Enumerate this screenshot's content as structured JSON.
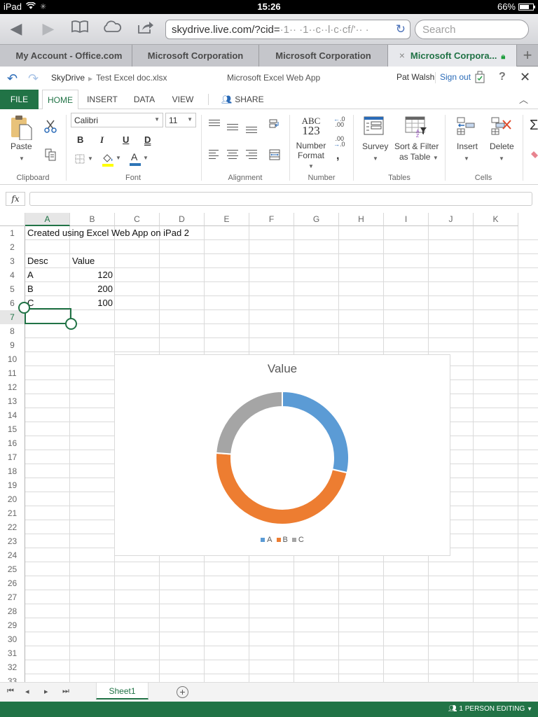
{
  "device_status": {
    "device": "iPad",
    "time": "15:26",
    "battery_percent": "66%",
    "battery_level": 0.66
  },
  "browser": {
    "url": "skydrive.live.com/?cid=",
    "url_obscured": "·1·· ·1··c··l·c·cf/'·· ·",
    "search_placeholder": "Search",
    "tabs": [
      {
        "label": "My Account - Office.com",
        "active": false
      },
      {
        "label": "Microsoft Corporation",
        "active": false
      },
      {
        "label": "Microsoft Corporation",
        "active": false
      },
      {
        "label": "Microsoft Corpora...",
        "active": true
      }
    ],
    "close_tab_glyph": "×",
    "new_tab_glyph": "+"
  },
  "app_header": {
    "breadcrumb_root": "SkyDrive",
    "file_name": "Test Excel doc.xlsx",
    "app_title": "Microsoft Excel Web App",
    "user_name": "Pat Walsh",
    "sign_out": "Sign out"
  },
  "ribbon_tabs": {
    "file": "FILE",
    "home": "HOME",
    "insert": "INSERT",
    "data": "DATA",
    "view": "VIEW",
    "share": "SHARE"
  },
  "ribbon": {
    "clipboard": {
      "paste": "Paste",
      "group_label": "Clipboard"
    },
    "font": {
      "font_name": "Calibri",
      "font_size": "11",
      "bold": "B",
      "italic": "I",
      "underline": "U",
      "double_underline": "D",
      "font_color_glyph": "A",
      "group_label": "Font",
      "highlight_color": "#ffff00",
      "font_color": "#2e75b6"
    },
    "alignment": {
      "group_label": "Alignment"
    },
    "number": {
      "abc_label": "ABC",
      "num_label": "123",
      "number_format_line1": "Number",
      "number_format_line2": "Format",
      "increase_decimal": "←.0 .00",
      "decrease_decimal": ".00 →.0",
      "comma": ",",
      "group_label": "Number"
    },
    "tables": {
      "survey": "Survey",
      "sort_filter_line1": "Sort & Filter",
      "sort_filter_line2": "as Table",
      "group_label": "Tables"
    },
    "cells": {
      "insert": "Insert",
      "delete": "Delete",
      "group_label": "Cells"
    },
    "editing": {
      "autosum_glyph": "Σ"
    }
  },
  "formula_bar": {
    "fx_label": "fx",
    "value": ""
  },
  "sheet": {
    "columns": [
      "A",
      "B",
      "C",
      "D",
      "E",
      "F",
      "G",
      "H",
      "I",
      "J",
      "K"
    ],
    "active_column": "A",
    "active_row": 7,
    "row_numbers": [
      "1",
      "2",
      "3",
      "4",
      "5",
      "6",
      "7",
      "8",
      "9",
      "10",
      "11",
      "12",
      "13",
      "14",
      "15",
      "16",
      "17",
      "18",
      "19",
      "20",
      "21",
      "22",
      "23",
      "24",
      "25",
      "26",
      "27",
      "28",
      "29",
      "30",
      "31",
      "32",
      "33"
    ],
    "cells": {
      "A1": "Created using Excel Web App on iPad 2",
      "A3": "Desc",
      "B3": "Value",
      "A4": "A",
      "B4": "120",
      "A5": "B",
      "B5": "200",
      "A6": "C",
      "B6": "100"
    }
  },
  "chart_data": {
    "type": "pie",
    "variant": "doughnut",
    "title": "Value",
    "categories": [
      "A",
      "B",
      "C"
    ],
    "values": [
      120,
      200,
      100
    ],
    "colors": [
      "#5b9bd5",
      "#ed7d31",
      "#a5a5a5"
    ],
    "legend": [
      "A",
      "B",
      "C"
    ],
    "legend_position": "bottom"
  },
  "sheet_tabs": {
    "tabs": [
      "Sheet1"
    ],
    "active": "Sheet1",
    "add_glyph": "+"
  },
  "status_bar": {
    "editing": "1 PERSON EDITING"
  }
}
